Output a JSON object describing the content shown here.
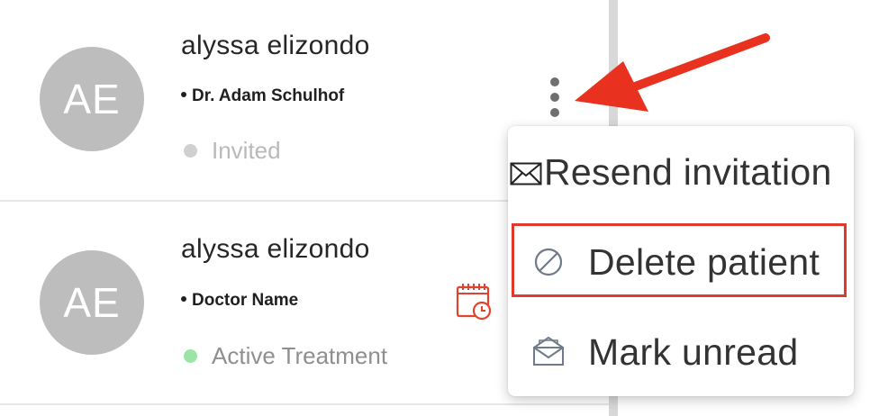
{
  "patients": [
    {
      "initials": "AE",
      "name": "alyssa elizondo",
      "doctor": "Dr. Adam Schulhof",
      "status": "Invited",
      "status_color": "#d0d0d0"
    },
    {
      "initials": "AE",
      "name": "alyssa elizondo",
      "doctor": "Doctor Name",
      "status": "Active Treatment",
      "status_color": "#9be3a6"
    }
  ],
  "context_menu": {
    "items": [
      {
        "label": "Resend invitation",
        "icon": "envelope-icon"
      },
      {
        "label": "Delete patient",
        "icon": "prohibited-icon",
        "highlighted": true
      },
      {
        "label": "Mark unread",
        "icon": "open-envelope-icon"
      }
    ]
  },
  "colors": {
    "annotation_red": "#e03a2c",
    "calendar_icon": "#e0442f",
    "avatar_bg": "#bdbdbd"
  },
  "icons": [
    "more-vertical-icon",
    "calendar-clock-icon",
    "annotation-arrow"
  ]
}
